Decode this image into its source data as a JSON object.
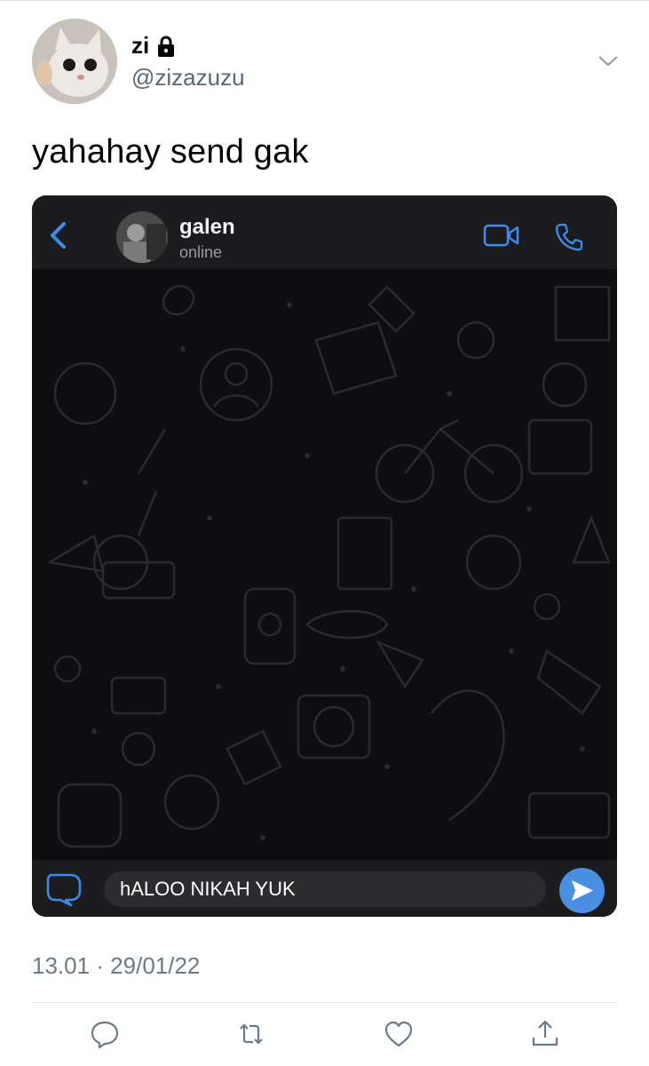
{
  "tweet": {
    "display_name": "zi",
    "handle": "@zizazuzu",
    "text": "yahahay send gak",
    "timestamp": "13.01 · 29/01/22"
  },
  "chat_screenshot": {
    "contact_name": "galen",
    "status": "online",
    "message_input": "hALOO NIKAH YUK"
  },
  "icons": {
    "lock": "lock-icon",
    "more": "chevron-down-icon",
    "back": "chevron-left-icon",
    "video": "video-call-icon",
    "call": "phone-icon",
    "sticker": "sticker-icon",
    "send": "send-icon",
    "reply": "reply-icon",
    "retweet": "retweet-icon",
    "like": "heart-icon",
    "share": "share-icon"
  },
  "colors": {
    "accent_blue": "#4a90e2",
    "secondary_text": "#586773",
    "chat_background": "#0e0e10"
  }
}
